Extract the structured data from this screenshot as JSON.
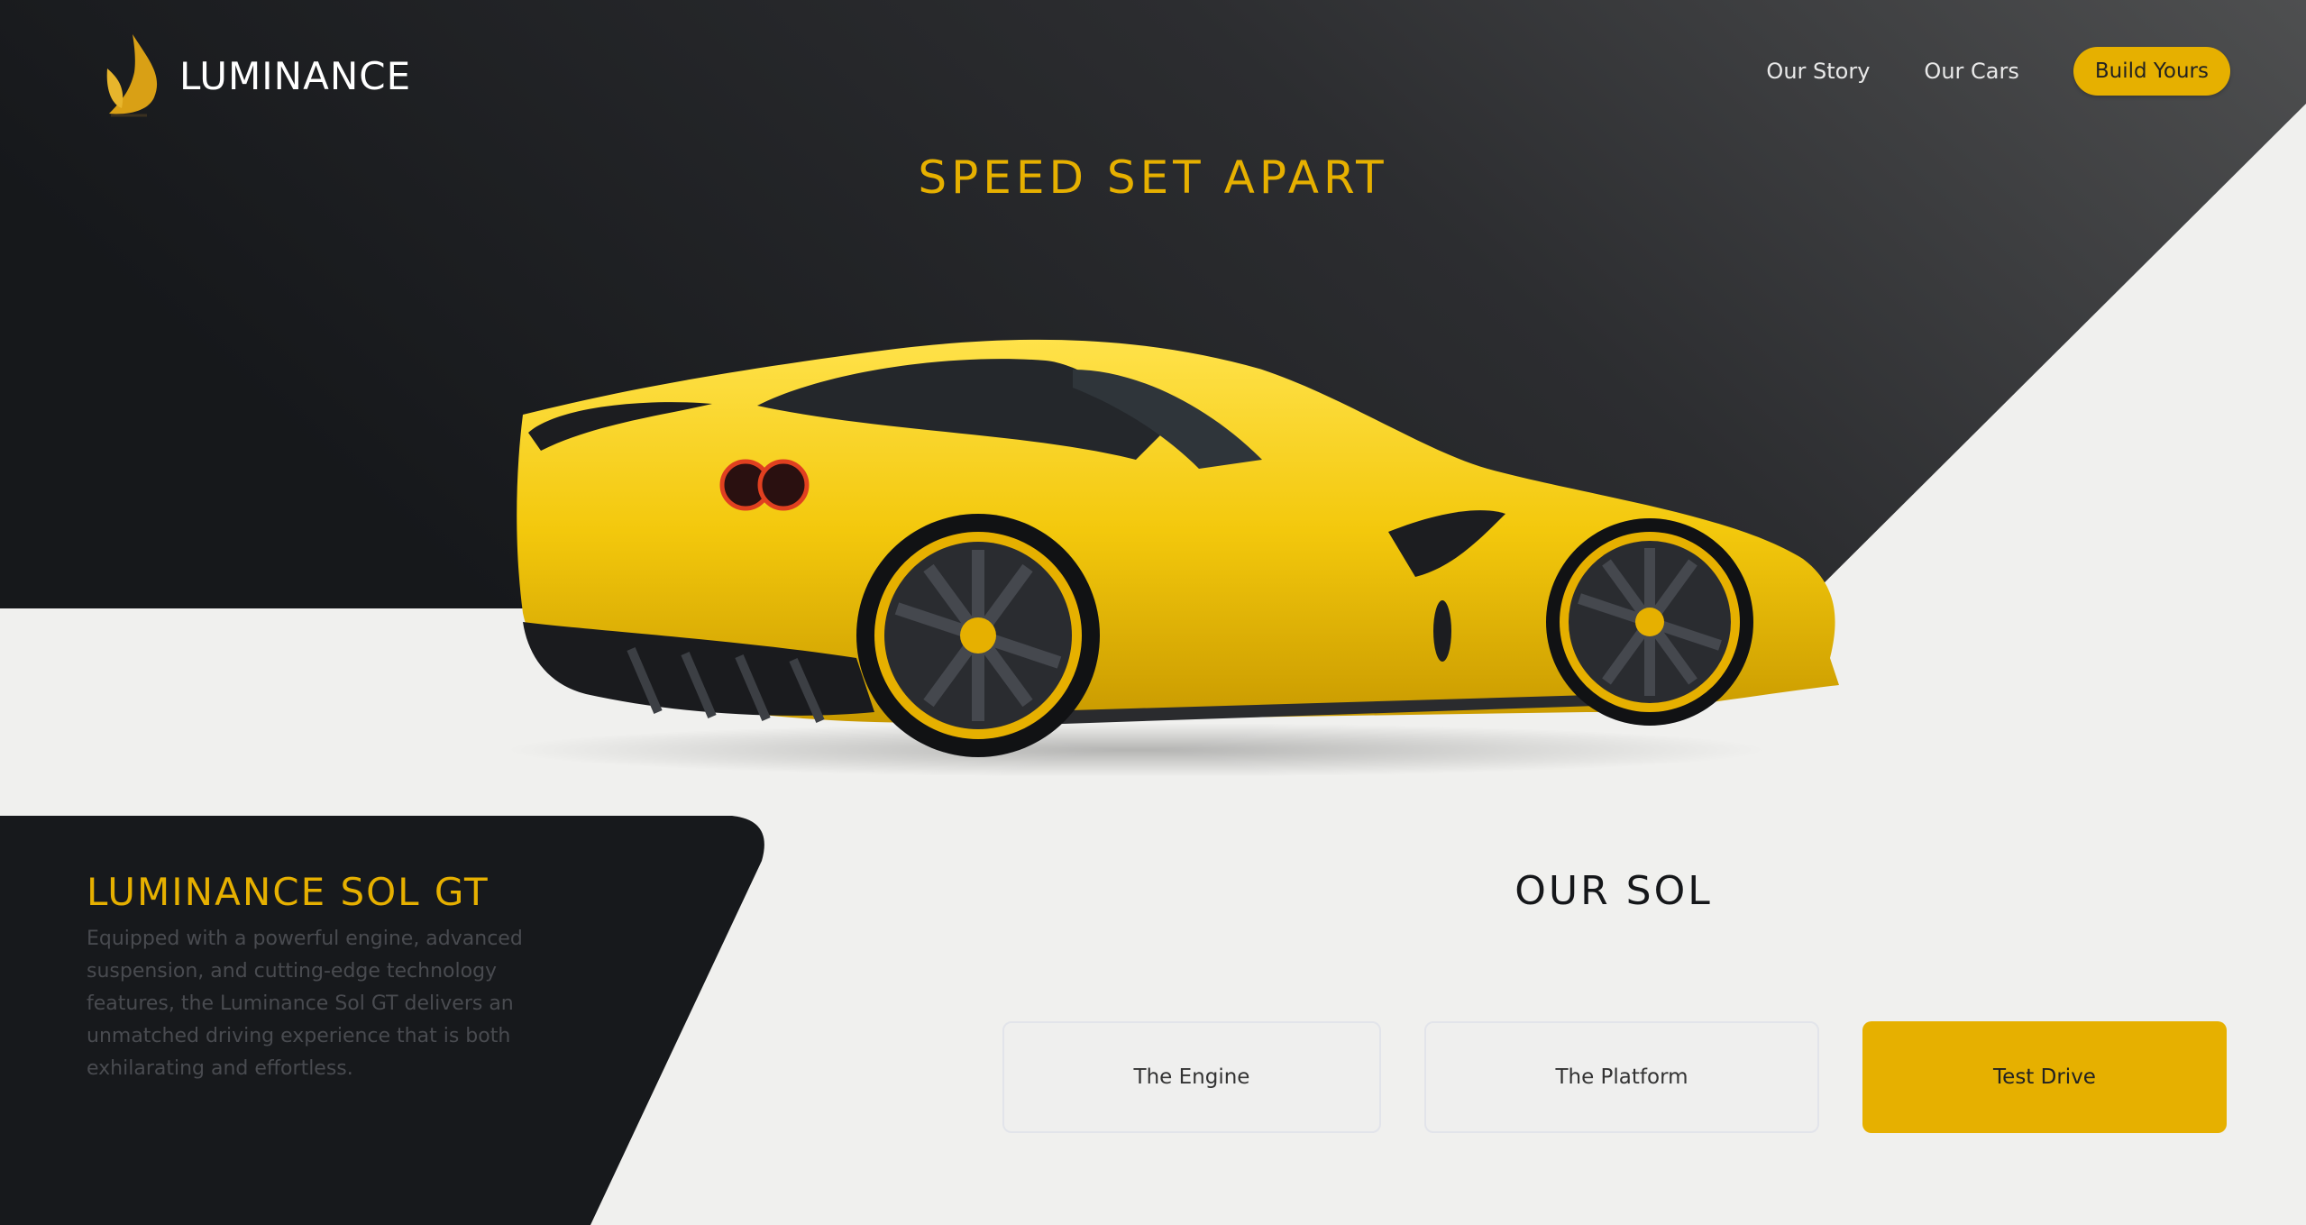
{
  "brand": {
    "name": "LUMINANCE"
  },
  "nav": {
    "links": [
      "Our Story",
      "Our Cars"
    ],
    "cta_label": "Build Yours"
  },
  "hero": {
    "tagline": "SPEED SET APART",
    "car_image": "yellow-sports-car"
  },
  "model": {
    "title": "LUMINANCE SOL GT",
    "description": "Equipped with a powerful engine, advanced suspension, and cutting-edge technology features, the Luminance Sol GT delivers an unmatched driving experience that is both exhilarating and effortless."
  },
  "section": {
    "title": "OUR SOL",
    "cards": [
      "The Engine",
      "The Platform",
      "Test Drive"
    ]
  },
  "colors": {
    "accent": "#e6b000",
    "dark": "#17191c",
    "light": "#f0f0ee"
  }
}
